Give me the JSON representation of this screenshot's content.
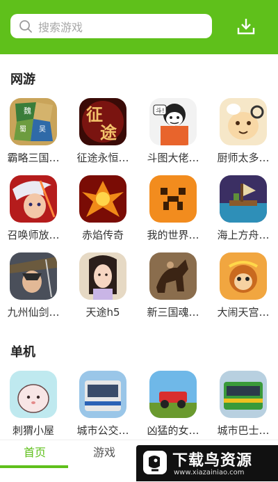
{
  "header": {
    "search_placeholder": "搜索游戏"
  },
  "sections": [
    {
      "title": "网游",
      "items": [
        {
          "label": "霸略三国…",
          "icon": "three-kingdoms-map-icon"
        },
        {
          "label": "征途永恒…",
          "icon": "zhengtu-logo-icon"
        },
        {
          "label": "斗图大佬…",
          "icon": "meme-face-icon"
        },
        {
          "label": "厨师太多…",
          "icon": "chef-cartoon-icon"
        },
        {
          "label": "召唤师放…",
          "icon": "white-hair-hero-icon"
        },
        {
          "label": "赤焰传奇",
          "icon": "phoenix-icon"
        },
        {
          "label": "我的世界…",
          "icon": "minecraft-face-icon"
        },
        {
          "label": "海上方舟…",
          "icon": "ocean-raft-icon"
        },
        {
          "label": "九州仙剑…",
          "icon": "swordsman-icon"
        },
        {
          "label": "天途h5",
          "icon": "fairy-lady-icon"
        },
        {
          "label": "新三国魂…",
          "icon": "war-horse-icon"
        },
        {
          "label": "大闹天宫…",
          "icon": "monkey-king-icon"
        }
      ]
    },
    {
      "title": "单机",
      "items": [
        {
          "label": "刺猬小屋",
          "icon": "hedgehog-icon"
        },
        {
          "label": "城市公交…",
          "icon": "city-bus-icon"
        },
        {
          "label": "凶猛的女…",
          "icon": "jeep-racing-icon"
        },
        {
          "label": "城市巴士…",
          "icon": "green-bus-icon"
        }
      ]
    }
  ],
  "tabs": [
    {
      "label": "首页",
      "active": true
    },
    {
      "label": "游戏",
      "active": false
    }
  ],
  "watermark": {
    "title": "下载鸟资源",
    "url": "www.xiazainiao.com"
  },
  "colors": {
    "accent": "#5fc01b"
  }
}
